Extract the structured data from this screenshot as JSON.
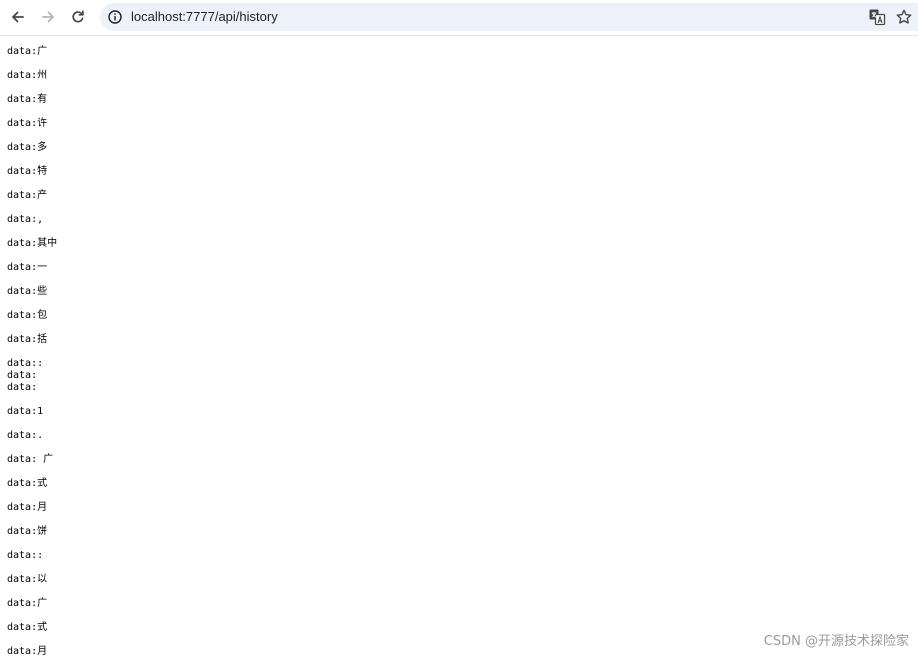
{
  "browser": {
    "url": "localhost:7777/api/history",
    "icons": {
      "back": "back-arrow-icon",
      "forward": "forward-arrow-icon",
      "reload": "reload-icon",
      "site_info": "info-icon",
      "translate": "translate-icon",
      "bookmark": "star-icon"
    }
  },
  "stream": [
    [
      "data:广"
    ],
    [
      "data:州"
    ],
    [
      "data:有"
    ],
    [
      "data:许"
    ],
    [
      "data:多"
    ],
    [
      "data:特"
    ],
    [
      "data:产"
    ],
    [
      "data:,"
    ],
    [
      "data:其中"
    ],
    [
      "data:一"
    ],
    [
      "data:些"
    ],
    [
      "data:包"
    ],
    [
      "data:括"
    ],
    [
      "data::",
      "data:",
      "data:"
    ],
    [
      "data:1"
    ],
    [
      "data:."
    ],
    [
      "data: 广"
    ],
    [
      "data:式"
    ],
    [
      "data:月"
    ],
    [
      "data:饼"
    ],
    [
      "data::"
    ],
    [
      "data:以"
    ],
    [
      "data:广"
    ],
    [
      "data:式"
    ],
    [
      "data:月"
    ]
  ],
  "watermark": "CSDN @开源技术探险家",
  "colors": {
    "omnibox": "#edf1f9",
    "watermark": "#9a9a9a"
  }
}
